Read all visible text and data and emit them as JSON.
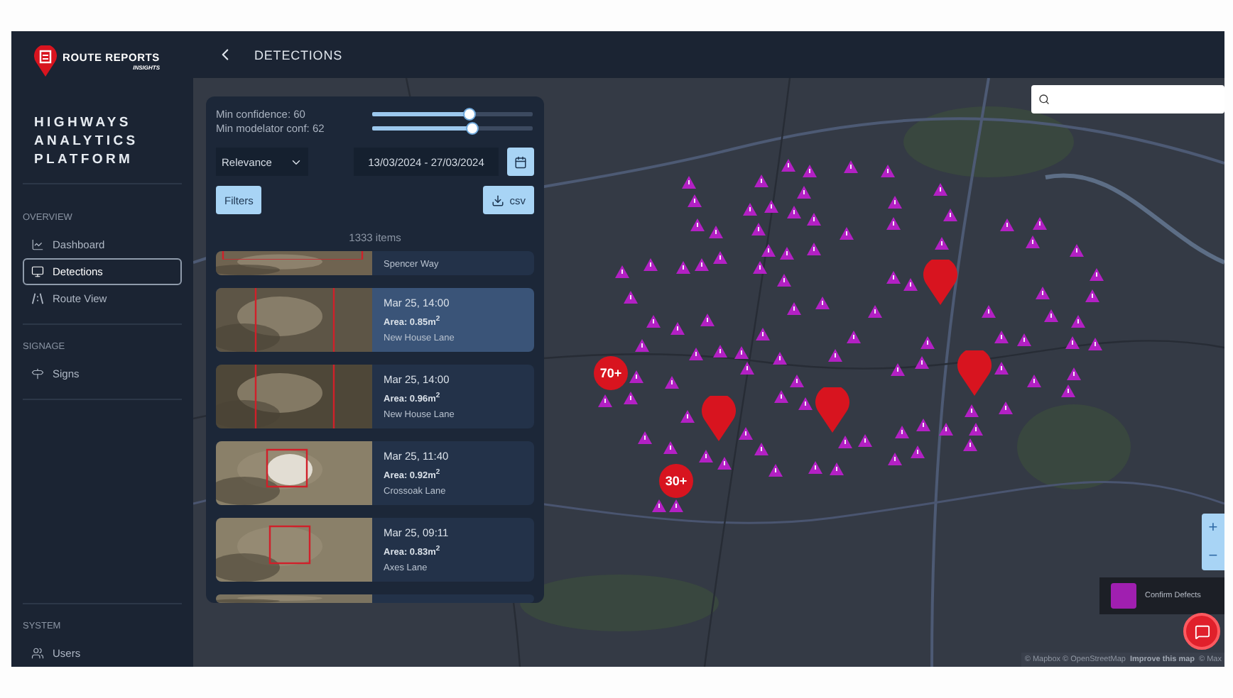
{
  "sidebar": {
    "brand": {
      "name": "ROUTE REPORTS",
      "tagline": "INSIGHTS"
    },
    "platform": "HIGHWAYS ANALYTICS PLATFORM",
    "sections": [
      {
        "title": "OVERVIEW",
        "items": [
          {
            "label": "Dashboard",
            "selected": false
          },
          {
            "label": "Detections",
            "selected": true
          },
          {
            "label": "Route View",
            "selected": false
          }
        ]
      },
      {
        "title": "SIGNAGE",
        "items": [
          {
            "label": "Signs",
            "selected": false
          }
        ]
      }
    ],
    "footer_section": {
      "title": "SYSTEM",
      "items": [
        {
          "label": "Users",
          "selected": false
        }
      ]
    }
  },
  "header": {
    "title": "DETECTIONS"
  },
  "panel": {
    "sliders": [
      {
        "label": "Min confidence: 60",
        "level": 0.6
      },
      {
        "label": "Min modelator conf: 62",
        "level": 0.62
      }
    ],
    "sort": {
      "value": "Relevance"
    },
    "date_range": {
      "value": "13/03/2024 - 27/03/2024"
    },
    "buttons": {
      "filters": "Filters",
      "export": "csv"
    },
    "count": "1333 items",
    "detections": [
      {
        "kind": "top-cut",
        "road": "Spencer Way",
        "selected": false
      },
      {
        "kind": "card",
        "time": "Mar 25, 14:00",
        "area": "Area: 0.85m$^{2}$",
        "road": "New House Lane",
        "selected": true
      },
      {
        "kind": "card",
        "time": "Mar 25, 14:00",
        "area": "Area: 0.96m$^{2}$",
        "road": "New House Lane",
        "selected": false
      },
      {
        "kind": "card",
        "time": "Mar 25, 11:40",
        "area": "Area: 0.92m$^{2}$",
        "road": "Crossoak Lane",
        "selected": false
      },
      {
        "kind": "card",
        "time": "Mar 25, 09:11",
        "area": "Area: 0.83m$^{2}$",
        "road": "Axes Lane",
        "selected": false
      },
      {
        "kind": "bottom-cut",
        "selected": false
      }
    ]
  },
  "map": {
    "markers": [
      {
        "kind": "cluster",
        "label": "70+"
      },
      {
        "kind": "cluster",
        "label": "30+"
      },
      {
        "kind": "pin"
      },
      {
        "kind": "pin"
      },
      {
        "kind": "pin"
      },
      {
        "kind": "pin"
      }
    ],
    "zoom": {
      "in": "+",
      "out": "−"
    },
    "legend": {
      "label": "Confirm Defects"
    },
    "attribution": {
      "text": "© Mapbox © OpenStreetMap",
      "link": "Improve this map",
      "tail": "© Max"
    }
  }
}
